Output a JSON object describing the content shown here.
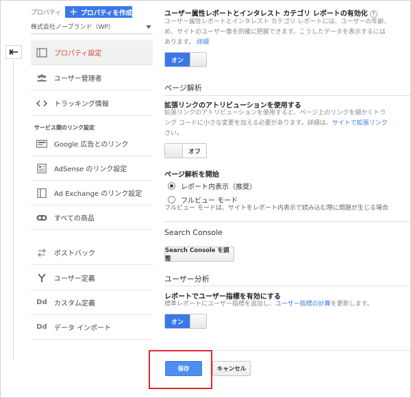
{
  "sidebar": {
    "property_label": "プロパティ",
    "create_property_label": "プロパティを作成",
    "account_name": "株式会社ノーブランド（WP）",
    "section_title": "サービス間のリンク設定",
    "items": [
      {
        "label": "プロパティ設定",
        "icon": "window-icon"
      },
      {
        "label": "ユーザー管理者",
        "icon": "users-icon"
      },
      {
        "label": "トラッキング情報",
        "icon": "code-icon"
      },
      {
        "label": "Google 広告とのリンク",
        "icon": "ads-icon"
      },
      {
        "label": "AdSense のリンク設定",
        "icon": "adsense-icon"
      },
      {
        "label": "Ad Exchange のリンク設定",
        "icon": "adexchange-icon"
      },
      {
        "label": "すべての商品",
        "icon": "infinity-icon"
      },
      {
        "label": "ポストバック",
        "icon": "postback-icon"
      },
      {
        "label": "ユーザー定義",
        "icon": "fork-icon"
      },
      {
        "label": "カスタム定義",
        "icon": "dd-icon"
      },
      {
        "label": "データ インポート",
        "icon": "dd-icon"
      }
    ],
    "dd_glyph": "Dd"
  },
  "main": {
    "demographics": {
      "title": "ユーザー属性レポートとインタレスト カテゴリ レポートの有効化",
      "desc_line1": "ユーザー属性レポートとインタレスト カテゴリ レポートには、ユーザーの年齢、",
      "desc_line2": "め、サイトのユーザー像を的確に把握できます。こうしたデータを表示するには",
      "desc_line3": "あります。",
      "desc_link": "詳細",
      "toggle": "オン",
      "help": "?"
    },
    "page_analytics_head": "ページ解析",
    "enhanced_link": {
      "title": "拡張リンクのアトリビューションを使用する",
      "desc_line1": "拡張リンクのアトリビューションを使用すると、ページ上のリンクを細かくトラ",
      "desc_line2_pre": "ング コードに小さな変更を加える必要があります。詳細は、",
      "desc_line2_link": "サイトで拡張リンク",
      "desc_line3": "さい。",
      "toggle": "オフ"
    },
    "page_analytics_start": {
      "title": "ページ解析を開始",
      "options": [
        "レポート内表示（推奨）",
        "フルビュー モード"
      ],
      "selected": 0,
      "note": "フルビュー モードは、サイトをレポート内表示で読み込む際に問題が生じる場合"
    },
    "search_console": {
      "head": "Search Console",
      "button": "Search Console を調整"
    },
    "user_analysis": {
      "head": "ユーザー分析",
      "title": "レポートでユーザー指標を有効にする",
      "desc_pre": "標準レポートにユーザー指標を追加し、",
      "desc_link": "ユーザー指標の計算",
      "desc_post": "を更新します。",
      "toggle": "オン"
    }
  },
  "footer": {
    "save": "保存",
    "cancel": "キャンセル"
  },
  "colors": {
    "accent": "#3b78e7",
    "active_nav": "#db4437",
    "highlight": "#e0232a"
  }
}
